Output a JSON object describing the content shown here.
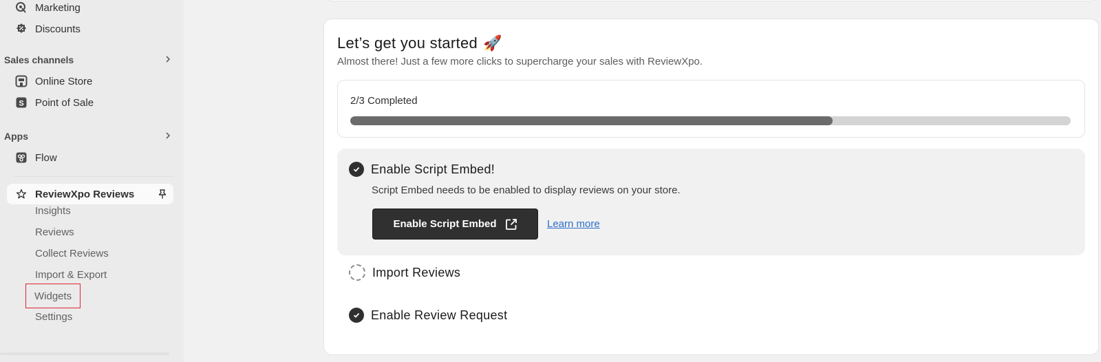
{
  "sidebar": {
    "marketing": "Marketing",
    "discounts": "Discounts",
    "sales_channels_heading": "Sales channels",
    "online_store": "Online Store",
    "point_of_sale": "Point of Sale",
    "apps_heading": "Apps",
    "flow": "Flow",
    "app_name": "ReviewXpo Reviews",
    "app_subitems": [
      "Insights",
      "Reviews",
      "Collect Reviews",
      "Import & Export",
      "Widgets",
      "Settings"
    ]
  },
  "onboarding": {
    "title": "Let’s get you started",
    "title_emoji": "🚀",
    "subtitle": "Almost there! Just a few more clicks to supercharge your sales with ReviewXpo.",
    "progress_label": "2/3 Completed",
    "progress_fraction": 0.67,
    "steps": [
      {
        "title": "Enable Script Embed!",
        "status": "complete",
        "description": "Script Embed needs to be enabled to display reviews on your store.",
        "button_label": "Enable Script Embed",
        "link_label": "Learn more"
      },
      {
        "title": "Import Reviews",
        "status": "incomplete"
      },
      {
        "title": "Enable Review Request",
        "status": "complete"
      }
    ]
  },
  "colors": {
    "accent_dark": "#303030",
    "link": "#2c6ecb",
    "highlight_outline": "#e0242f"
  }
}
